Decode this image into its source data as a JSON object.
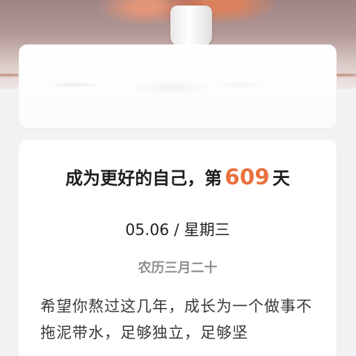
{
  "header": {
    "photo_icon": "flower-vase-photo"
  },
  "main_card": {
    "title_prefix": "成为更好的自己，第",
    "day_count": "609",
    "title_suffix": "天",
    "date": "05.06",
    "separator": "/",
    "weekday": "星期三",
    "lunar_date": "农历三月二十",
    "quote": "希望你熬过这几年，成长为一个做事不拖泥带水，足够独立，足够坚"
  },
  "colors": {
    "accent": "#e9713d",
    "background": "#f2f2f4",
    "card": "#ffffff"
  }
}
